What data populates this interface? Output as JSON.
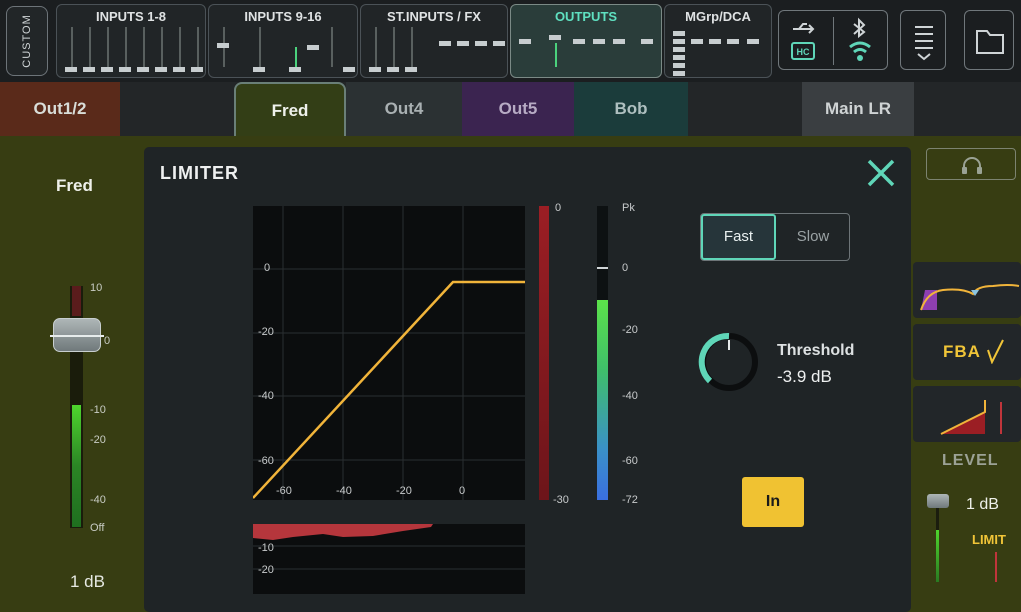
{
  "topbar": {
    "custom_label": "CUSTOM",
    "groups": [
      {
        "label": "INPUTS 1-8"
      },
      {
        "label": "INPUTS 9-16"
      },
      {
        "label": "ST.INPUTS / FX"
      },
      {
        "label": "OUTPUTS"
      },
      {
        "label": "MGrp/DCA"
      }
    ],
    "icons": [
      "usb-icon",
      "sd-card-icon",
      "bluetooth-icon",
      "wifi-icon",
      "menu-icon",
      "folder-icon"
    ]
  },
  "tabs": [
    {
      "label": "Out1/2",
      "color": "#5a2a1a"
    },
    {
      "label": "Fred",
      "color": "#333e16",
      "active": true
    },
    {
      "label": "Out4",
      "color": "#2b3133"
    },
    {
      "label": "Out5",
      "color": "#3b2450"
    },
    {
      "label": "Bob",
      "color": "#1b3c3b"
    },
    {
      "label": "Main LR",
      "color": "#3a3e41"
    }
  ],
  "fader": {
    "name": "Fred",
    "value": "1 dB",
    "scale": [
      "10",
      "0",
      "-10",
      "-20",
      "-40",
      "Off"
    ]
  },
  "dialog": {
    "title": "LIMITER",
    "graph_y_labels": [
      "0",
      "-20",
      "-40",
      "-60"
    ],
    "graph_x_labels": [
      "-60",
      "-40",
      "-20",
      "0"
    ],
    "gr_labels": [
      "-10",
      "-20"
    ],
    "gr_meter_labels": [
      "0",
      "-30"
    ],
    "out_meter_labels": [
      "Pk",
      "0",
      "-20",
      "-40",
      "-60",
      "-72"
    ],
    "speed": {
      "fast": "Fast",
      "slow": "Slow",
      "selected": "Fast"
    },
    "threshold": {
      "label": "Threshold",
      "value": "-3.9 dB"
    },
    "in_label": "In"
  },
  "right_panel": {
    "fba_label": "FBA",
    "level_label": "LEVEL",
    "level_value": "1 dB",
    "limit_label": "LIMIT"
  },
  "colors": {
    "accent": "#5fd6b8",
    "in_button": "#f0c232",
    "curve": "#f1b43a"
  }
}
